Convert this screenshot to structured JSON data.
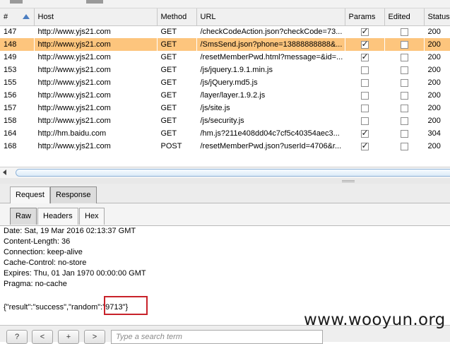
{
  "history_table": {
    "columns": [
      "#",
      "Host",
      "Method",
      "URL",
      "Params",
      "Edited",
      "Status"
    ],
    "rows": [
      {
        "num": "147",
        "host": "http://www.yjs21.com",
        "method": "GET",
        "url": "/checkCodeAction.json?checkCode=73...",
        "params": true,
        "edited": false,
        "status": "200",
        "selected": false
      },
      {
        "num": "148",
        "host": "http://www.yjs21.com",
        "method": "GET",
        "url": "/SmsSend.json?phone=13888888888&...",
        "params": true,
        "edited": false,
        "status": "200",
        "selected": true
      },
      {
        "num": "149",
        "host": "http://www.yjs21.com",
        "method": "GET",
        "url": "/resetMemberPwd.html?message=&id=...",
        "params": true,
        "edited": false,
        "status": "200",
        "selected": false
      },
      {
        "num": "153",
        "host": "http://www.yjs21.com",
        "method": "GET",
        "url": "/js/jquery.1.9.1.min.js",
        "params": false,
        "edited": false,
        "status": "200",
        "selected": false
      },
      {
        "num": "155",
        "host": "http://www.yjs21.com",
        "method": "GET",
        "url": "/js/jQuery.md5.js",
        "params": false,
        "edited": false,
        "status": "200",
        "selected": false
      },
      {
        "num": "156",
        "host": "http://www.yjs21.com",
        "method": "GET",
        "url": "/layer/layer.1.9.2.js",
        "params": false,
        "edited": false,
        "status": "200",
        "selected": false
      },
      {
        "num": "157",
        "host": "http://www.yjs21.com",
        "method": "GET",
        "url": "/js/site.js",
        "params": false,
        "edited": false,
        "status": "200",
        "selected": false
      },
      {
        "num": "158",
        "host": "http://www.yjs21.com",
        "method": "GET",
        "url": "/js/security.js",
        "params": false,
        "edited": false,
        "status": "200",
        "selected": false
      },
      {
        "num": "164",
        "host": "http://hm.baidu.com",
        "method": "GET",
        "url": "/hm.js?211e408dd04c7cf5c40354aec3...",
        "params": true,
        "edited": false,
        "status": "304",
        "selected": false
      },
      {
        "num": "168",
        "host": "http://www.yjs21.com",
        "method": "POST",
        "url": "/resetMemberPwd.json?userId=4706&r...",
        "params": true,
        "edited": false,
        "status": "200",
        "selected": false
      }
    ]
  },
  "message_tabs": {
    "request": "Request",
    "response": "Response",
    "active": "Response"
  },
  "view_tabs": {
    "raw": "Raw",
    "headers": "Headers",
    "hex": "Hex",
    "active": "Raw"
  },
  "response": {
    "headers": [
      "Date: Sat, 19 Mar 2016 02:13:37 GMT",
      "Content-Length: 36",
      "Connection: keep-alive",
      "Cache-Control: no-store",
      "Expires: Thu, 01 Jan 1970 00:00:00 GMT",
      "Pragma: no-cache"
    ],
    "body": "{\"result\":\"success\",\"random\":\"9713\"}"
  },
  "bottom_bar": {
    "help_label": "?",
    "prev_label": "<",
    "add_label": "+",
    "next_label": ">",
    "search_placeholder": "Type a search term"
  },
  "watermark": "www.wooyun.org",
  "colors": {
    "selected_row": "#fdc57d",
    "annotation_box": "#c8222a"
  }
}
